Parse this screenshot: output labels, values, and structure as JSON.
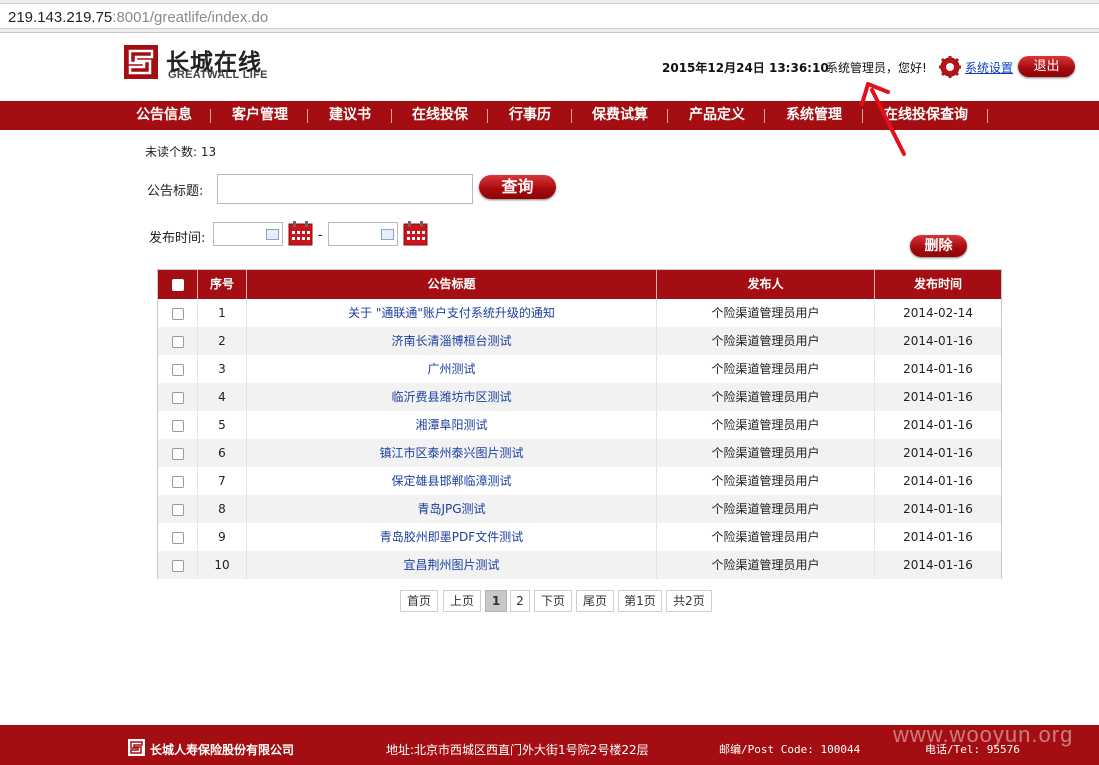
{
  "browser": {
    "url_host": "219.143.219.75",
    "url_rest": ":8001/greatlife/index.do"
  },
  "header": {
    "logo_cn": "长城在线",
    "logo_en": "GREATWALL LIFE",
    "datetime": "2015年12月24日 13:36:10",
    "greeting": "系统管理员，您好!",
    "settings_label": "系统设置",
    "logout_label": "退出"
  },
  "nav": {
    "items": [
      {
        "label": "公告信息"
      },
      {
        "label": "客户管理"
      },
      {
        "label": "建议书"
      },
      {
        "label": "在线投保"
      },
      {
        "label": "行事历"
      },
      {
        "label": "保费试算"
      },
      {
        "label": "产品定义"
      },
      {
        "label": "系统管理"
      },
      {
        "label": "在线投保查询"
      }
    ]
  },
  "filters": {
    "unread_text": "未读个数: 13",
    "title_label": "公告标题:",
    "title_value": "",
    "query_label": "查询",
    "date_label": "发布时间:",
    "date_sep": "-",
    "date_from": "",
    "date_to": "",
    "delete_label": "删除"
  },
  "table": {
    "headers": [
      "序号",
      "公告标题",
      "发布人",
      "发布时间"
    ],
    "rows": [
      {
        "no": "1",
        "title": "关于 \"通联通\"账户支付系统升级的通知",
        "publisher": "个险渠道管理员用户",
        "date": "2014-02-14"
      },
      {
        "no": "2",
        "title": "济南长清淄博桓台测试",
        "publisher": "个险渠道管理员用户",
        "date": "2014-01-16"
      },
      {
        "no": "3",
        "title": "广州测试",
        "publisher": "个险渠道管理员用户",
        "date": "2014-01-16"
      },
      {
        "no": "4",
        "title": "临沂费县潍坊市区测试",
        "publisher": "个险渠道管理员用户",
        "date": "2014-01-16"
      },
      {
        "no": "5",
        "title": "湘潭阜阳测试",
        "publisher": "个险渠道管理员用户",
        "date": "2014-01-16"
      },
      {
        "no": "6",
        "title": "镇江市区泰州泰兴图片测试",
        "publisher": "个险渠道管理员用户",
        "date": "2014-01-16"
      },
      {
        "no": "7",
        "title": "保定雄县邯郸临漳测试",
        "publisher": "个险渠道管理员用户",
        "date": "2014-01-16"
      },
      {
        "no": "8",
        "title": "青岛JPG测试",
        "publisher": "个险渠道管理员用户",
        "date": "2014-01-16"
      },
      {
        "no": "9",
        "title": "青岛胶州即墨PDF文件测试",
        "publisher": "个险渠道管理员用户",
        "date": "2014-01-16"
      },
      {
        "no": "10",
        "title": "宜昌荆州图片测试",
        "publisher": "个险渠道管理员用户",
        "date": "2014-01-16"
      }
    ]
  },
  "pagination": {
    "first": "首页",
    "prev": "上页",
    "pages": [
      "1",
      "2"
    ],
    "current": "1",
    "next": "下页",
    "last": "尾页",
    "page_info": "第1页",
    "total": "共2页"
  },
  "footer": {
    "company": "长城人寿保险股份有限公司",
    "address": "地址:北京市西城区西直门外大街1号院2号楼22层",
    "postcode": "邮编/Post Code: 100044",
    "phone": "电话/Tel: 95576"
  },
  "watermark": "www.wooyun.org",
  "colors": {
    "brand_red": "#a40e12",
    "link_blue": "#1a3fa0",
    "annotation_red": "#e3101a"
  }
}
